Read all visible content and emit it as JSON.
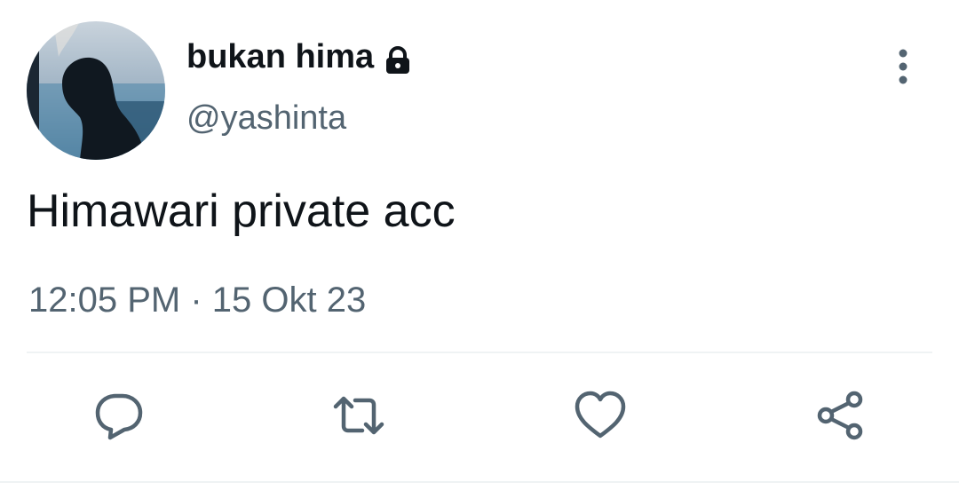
{
  "tweet": {
    "display_name": "bukan hima",
    "handle": "@yashinta",
    "text": "Himawari private acc",
    "timestamp": "12:05 PM",
    "separator": "·",
    "date": "15 Okt 23",
    "protected": true
  },
  "icons": {
    "lock": "lock-icon",
    "more": "more-vertical-icon",
    "reply": "reply-icon",
    "retweet": "retweet-icon",
    "like": "heart-icon",
    "share": "share-icon"
  },
  "colors": {
    "primary_text": "#0f1419",
    "secondary_text": "#536471",
    "divider": "#eff3f4"
  }
}
